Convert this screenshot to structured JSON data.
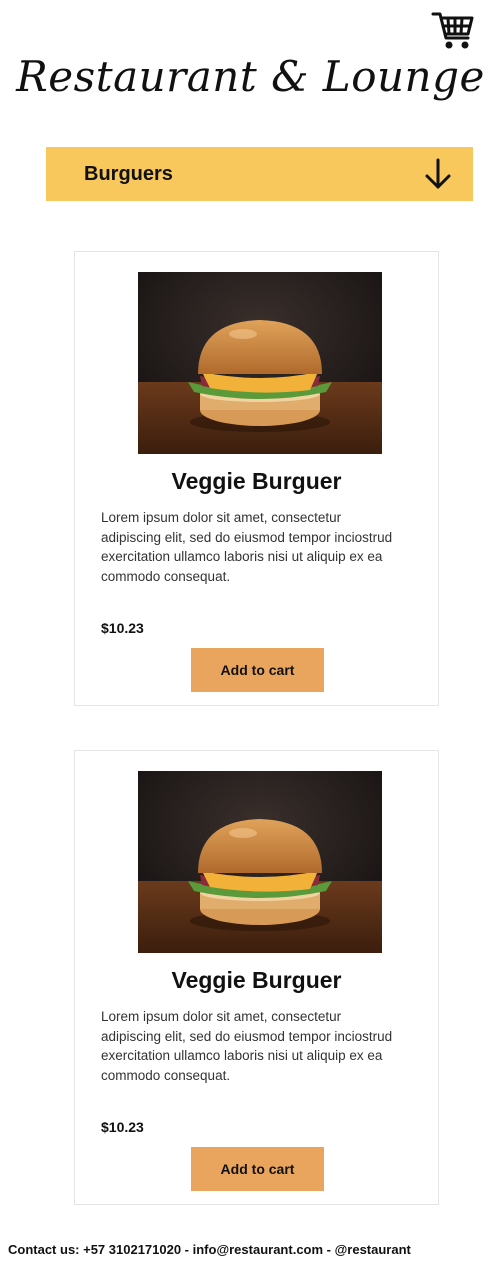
{
  "header": {
    "brand": "Restaurant & Lounge",
    "cart_icon": "shopping-cart-icon"
  },
  "category": {
    "selected": "Burguers",
    "icon": "arrow-down-icon"
  },
  "products": [
    {
      "name": "Veggie Burguer",
      "description": "Lorem ipsum dolor sit amet, consectetur adipiscing elit, sed do eiusmod tempor inciostrud exercitation ullamco laboris nisi ut aliquip ex ea commodo consequat.",
      "price": "$10.23",
      "button": "Add to cart"
    },
    {
      "name": "Veggie Burguer",
      "description": "Lorem ipsum dolor sit amet, consectetur adipiscing elit, sed do eiusmod tempor inciostrud exercitation ullamco laboris nisi ut aliquip ex ea commodo consequat.",
      "price": "$10.23",
      "button": "Add to cart"
    }
  ],
  "footer": {
    "text": "Contact us: +57 3102171020 - info@restaurant.com  - @restaurant"
  },
  "colors": {
    "category_bar": "#F9C85C",
    "button": "#E9A55E"
  }
}
